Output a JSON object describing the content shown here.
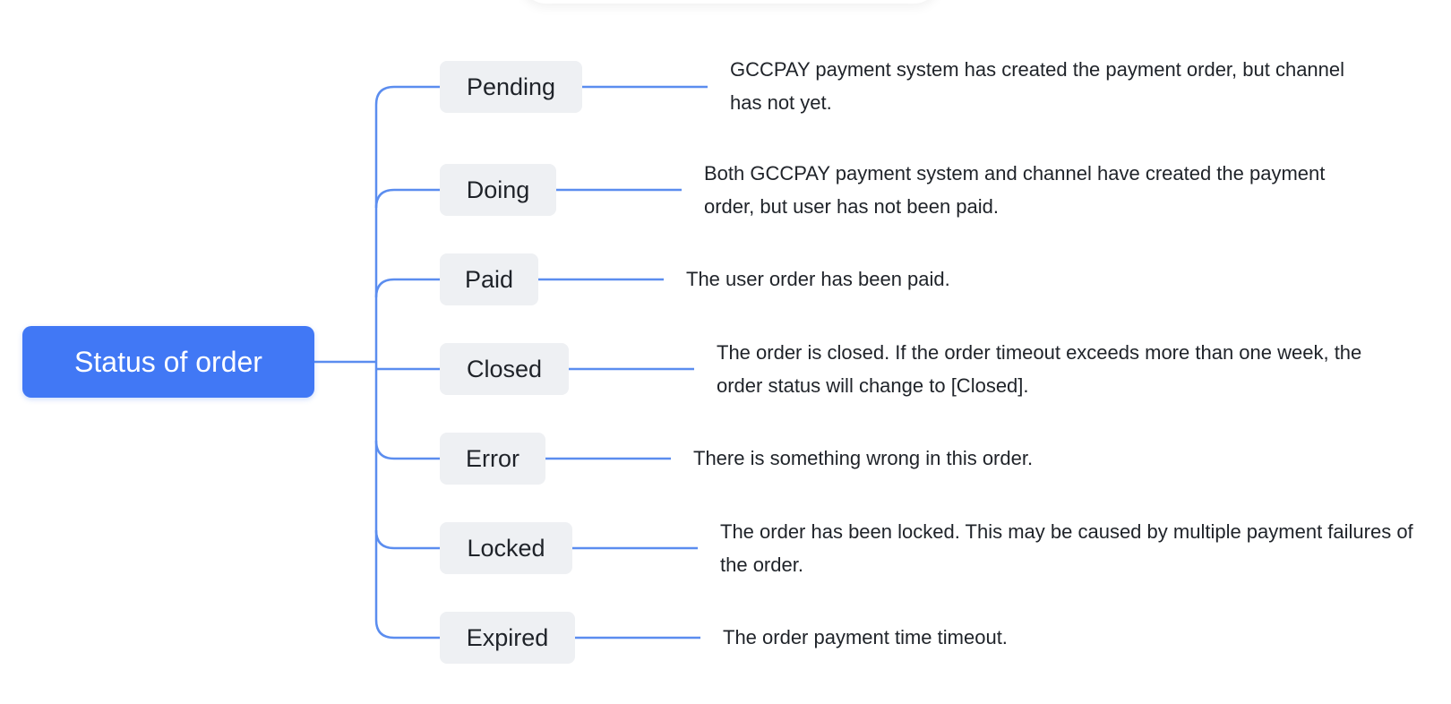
{
  "root": {
    "label": "Status of order"
  },
  "statuses": [
    {
      "label": "Pending",
      "description": "GCCPAY payment system has created the payment order, but channel has not yet."
    },
    {
      "label": "Doing",
      "description": "Both GCCPAY payment system and channel have created the payment order, but user has not been paid."
    },
    {
      "label": "Paid",
      "description": "The user order has been paid."
    },
    {
      "label": "Closed",
      "description": "The order is closed. If the order timeout exceeds more than one week, the order status will change to [Closed]."
    },
    {
      "label": "Error",
      "description": "There is something wrong in this order."
    },
    {
      "label": "Locked",
      "description": "The order has been locked. This may be caused by multiple payment failures of the order."
    },
    {
      "label": "Expired",
      "description": "The order payment time timeout."
    }
  ],
  "colors": {
    "root_fill": "#4178f5",
    "connector": "#5b8def",
    "status_fill": "#eef0f3"
  }
}
